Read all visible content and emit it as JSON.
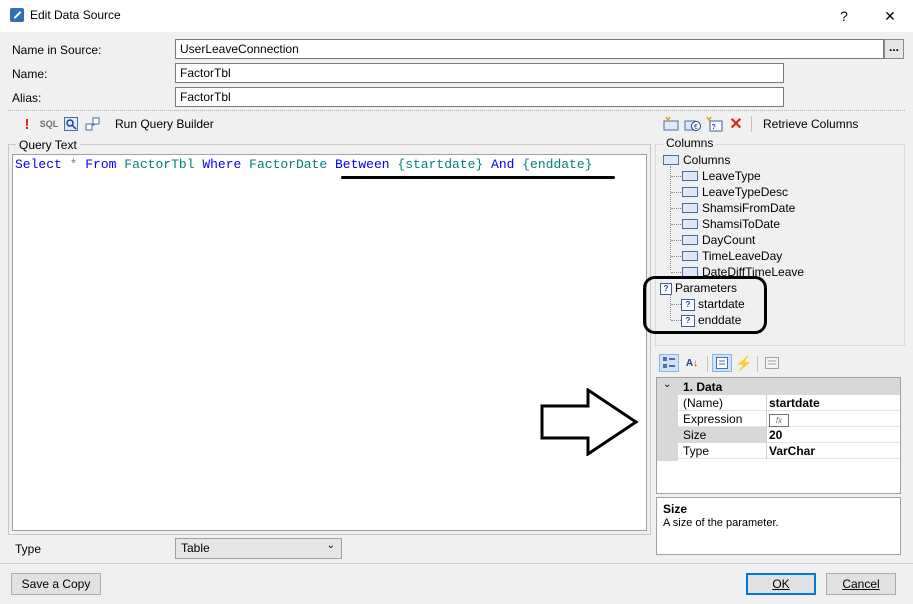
{
  "window": {
    "title": "Edit Data Source",
    "help_glyph": "?",
    "close_glyph": "✕"
  },
  "fields": {
    "name_in_source_label": "Name in Source:",
    "name_in_source_value": "UserLeaveConnection",
    "name_in_source_browse": "...",
    "name_label": "Name:",
    "name_value": "FactorTbl",
    "alias_label": "Alias:",
    "alias_value": "FactorTbl"
  },
  "query_toolbar": {
    "icons": [
      "exclamation-icon",
      "sql-icon",
      "query-view-icon",
      "query-builder-icon"
    ],
    "sql_text": "SQL",
    "run_query_builder": "Run Query Builder"
  },
  "query_text": {
    "legend": "Query Text",
    "tokens": [
      {
        "text": "Select",
        "cls": "kw"
      },
      {
        "text": " ",
        "cls": ""
      },
      {
        "text": "*",
        "cls": "grey"
      },
      {
        "text": " ",
        "cls": ""
      },
      {
        "text": "From",
        "cls": "kw"
      },
      {
        "text": " ",
        "cls": ""
      },
      {
        "text": "FactorTbl",
        "cls": "tbl"
      },
      {
        "text": " ",
        "cls": ""
      },
      {
        "text": "Where",
        "cls": "kw"
      },
      {
        "text": " ",
        "cls": ""
      },
      {
        "text": "FactorDate",
        "cls": "tbl"
      },
      {
        "text": " ",
        "cls": ""
      },
      {
        "text": "Between",
        "cls": "kw"
      },
      {
        "text": " ",
        "cls": ""
      },
      {
        "text": "{startdate}",
        "cls": "param"
      },
      {
        "text": " ",
        "cls": ""
      },
      {
        "text": "And",
        "cls": "kw"
      },
      {
        "text": " ",
        "cls": ""
      },
      {
        "text": "{enddate}",
        "cls": "param"
      }
    ]
  },
  "type_field": {
    "label": "Type",
    "selected": "Table"
  },
  "columns_toolbar": {
    "icons": [
      "new-column-icon",
      "new-calc-column-icon",
      "new-parameter-icon",
      "delete-icon"
    ],
    "retrieve_columns": "Retrieve Columns"
  },
  "columns_panel": {
    "legend": "Columns",
    "root_label": "Columns",
    "columns": [
      "LeaveType",
      "LeaveTypeDesc",
      "ShamsiFromDate",
      "ShamsiToDate",
      "DayCount",
      "TimeLeaveDay",
      "DateDiffTimeLeave"
    ],
    "parameters_label": "Parameters",
    "parameters": [
      "startdate",
      "enddate"
    ]
  },
  "property_grid": {
    "category": "1. Data",
    "rows": [
      {
        "name": "(Name)",
        "value": "startdate"
      },
      {
        "name": "Expression",
        "value": ""
      },
      {
        "name": "Size",
        "value": "20"
      },
      {
        "name": "Type",
        "value": "VarChar"
      }
    ],
    "expression_button": "fx",
    "description_title": "Size",
    "description_text": "A size of the parameter."
  },
  "buttons": {
    "save_copy": "Save a Copy",
    "ok": "OK",
    "cancel": "Cancel"
  },
  "colors": {
    "keyword": "#0000ff",
    "identifier": "#008080",
    "operator": "#808080",
    "selection": "#0078d7"
  }
}
